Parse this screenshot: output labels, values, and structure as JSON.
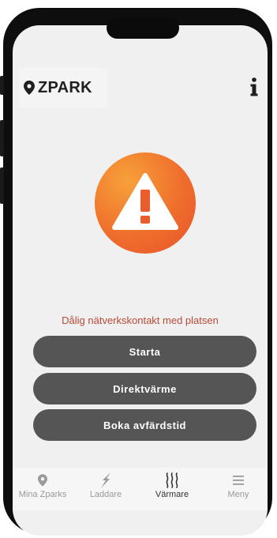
{
  "header": {
    "brand": "ZPARK"
  },
  "status": {
    "message": "Dålig nätverkskontakt med platsen"
  },
  "actions": [
    {
      "label": "Starta"
    },
    {
      "label": "Direktvärme"
    },
    {
      "label": "Boka avfärdstid"
    }
  ],
  "nav": [
    {
      "label": "Mina Zparks",
      "icon": "pin-icon"
    },
    {
      "label": "Laddare",
      "icon": "lightning-icon"
    },
    {
      "label": "Värmare",
      "icon": "heat-icon",
      "active": true
    },
    {
      "label": "Meny",
      "icon": "menu-icon"
    }
  ],
  "colors": {
    "accent": "#ef6e2c",
    "error_text": "#b94a36",
    "button": "#555555"
  }
}
